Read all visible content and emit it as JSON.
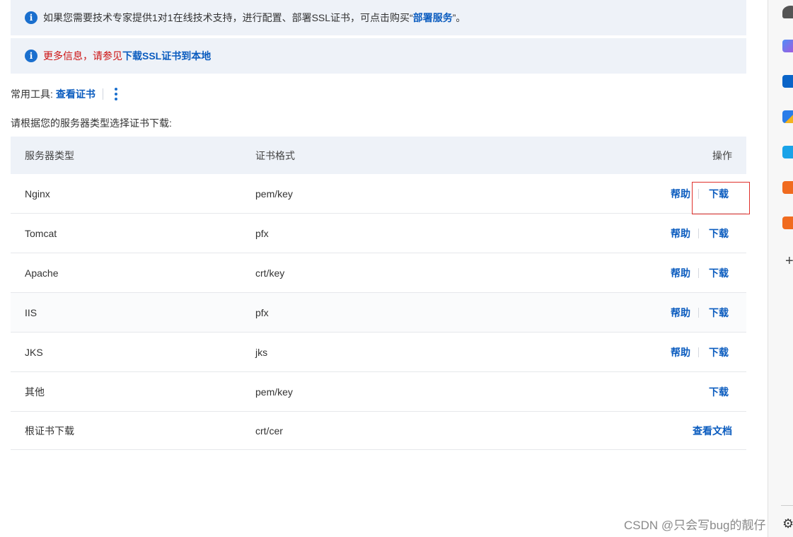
{
  "notices": {
    "support": {
      "text_before": "如果您需要技术专家提供1对1在线技术支持，进行配置、部署SSL证书，可点击购买“",
      "link": "部署服务",
      "text_after": "”。"
    },
    "more_info": {
      "text": "更多信息，请参见",
      "link": "下载SSL证书到本地"
    }
  },
  "tools": {
    "label": "常用工具:",
    "view_cert": "查看证书"
  },
  "prompt": "请根据您的服务器类型选择证书下载:",
  "table": {
    "headers": [
      "服务器类型",
      "证书格式",
      "操作"
    ],
    "rows": [
      {
        "server": "Nginx",
        "format": "pem/key",
        "help": "帮助",
        "action": "下载"
      },
      {
        "server": "Tomcat",
        "format": "pfx",
        "help": "帮助",
        "action": "下载"
      },
      {
        "server": "Apache",
        "format": "crt/key",
        "help": "帮助",
        "action": "下载"
      },
      {
        "server": "IIS",
        "format": "pfx",
        "help": "帮助",
        "action": "下载"
      },
      {
        "server": "JKS",
        "format": "jks",
        "help": "帮助",
        "action": "下载"
      },
      {
        "server": "其他",
        "format": "pem/key",
        "help": "",
        "action": "下载"
      },
      {
        "server": "根证书下载",
        "format": "crt/cer",
        "help": "",
        "action": "查看文档"
      }
    ]
  },
  "watermark": "CSDN @只会写bug的靓仔",
  "colors": {
    "link": "#0b5cbf",
    "notice_bg": "#eef2f8",
    "highlight": "#e0302b",
    "warning_text": "#cc1111"
  },
  "sidebar_icons": [
    "user-icon",
    "copilot-icon",
    "outlook-icon",
    "send-icon",
    "tv-icon",
    "app-icon",
    "app-icon",
    "add-icon",
    "settings-icon"
  ]
}
